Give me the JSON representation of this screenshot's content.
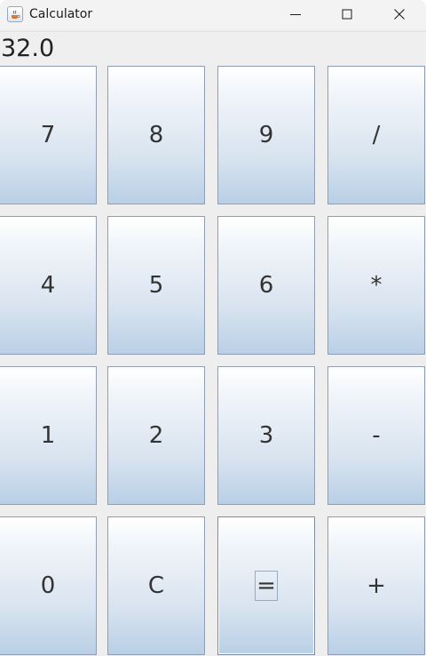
{
  "window": {
    "title": "Calculator",
    "icon": "java-cup-icon",
    "controls": [
      "minimize-icon",
      "maximize-icon",
      "close-icon"
    ]
  },
  "display": {
    "value": "32.0"
  },
  "keypad": {
    "rows": [
      [
        "7",
        "8",
        "9",
        "/"
      ],
      [
        "4",
        "5",
        "6",
        "*"
      ],
      [
        "1",
        "2",
        "3",
        "-"
      ],
      [
        "0",
        "C",
        "=",
        "+"
      ]
    ],
    "focused_key": "="
  },
  "colors": {
    "key_gradient_top": "#ffffff",
    "key_gradient_bottom": "#b9cfe6",
    "key_border": "#8f9eb4",
    "background": "#eeeeee"
  }
}
